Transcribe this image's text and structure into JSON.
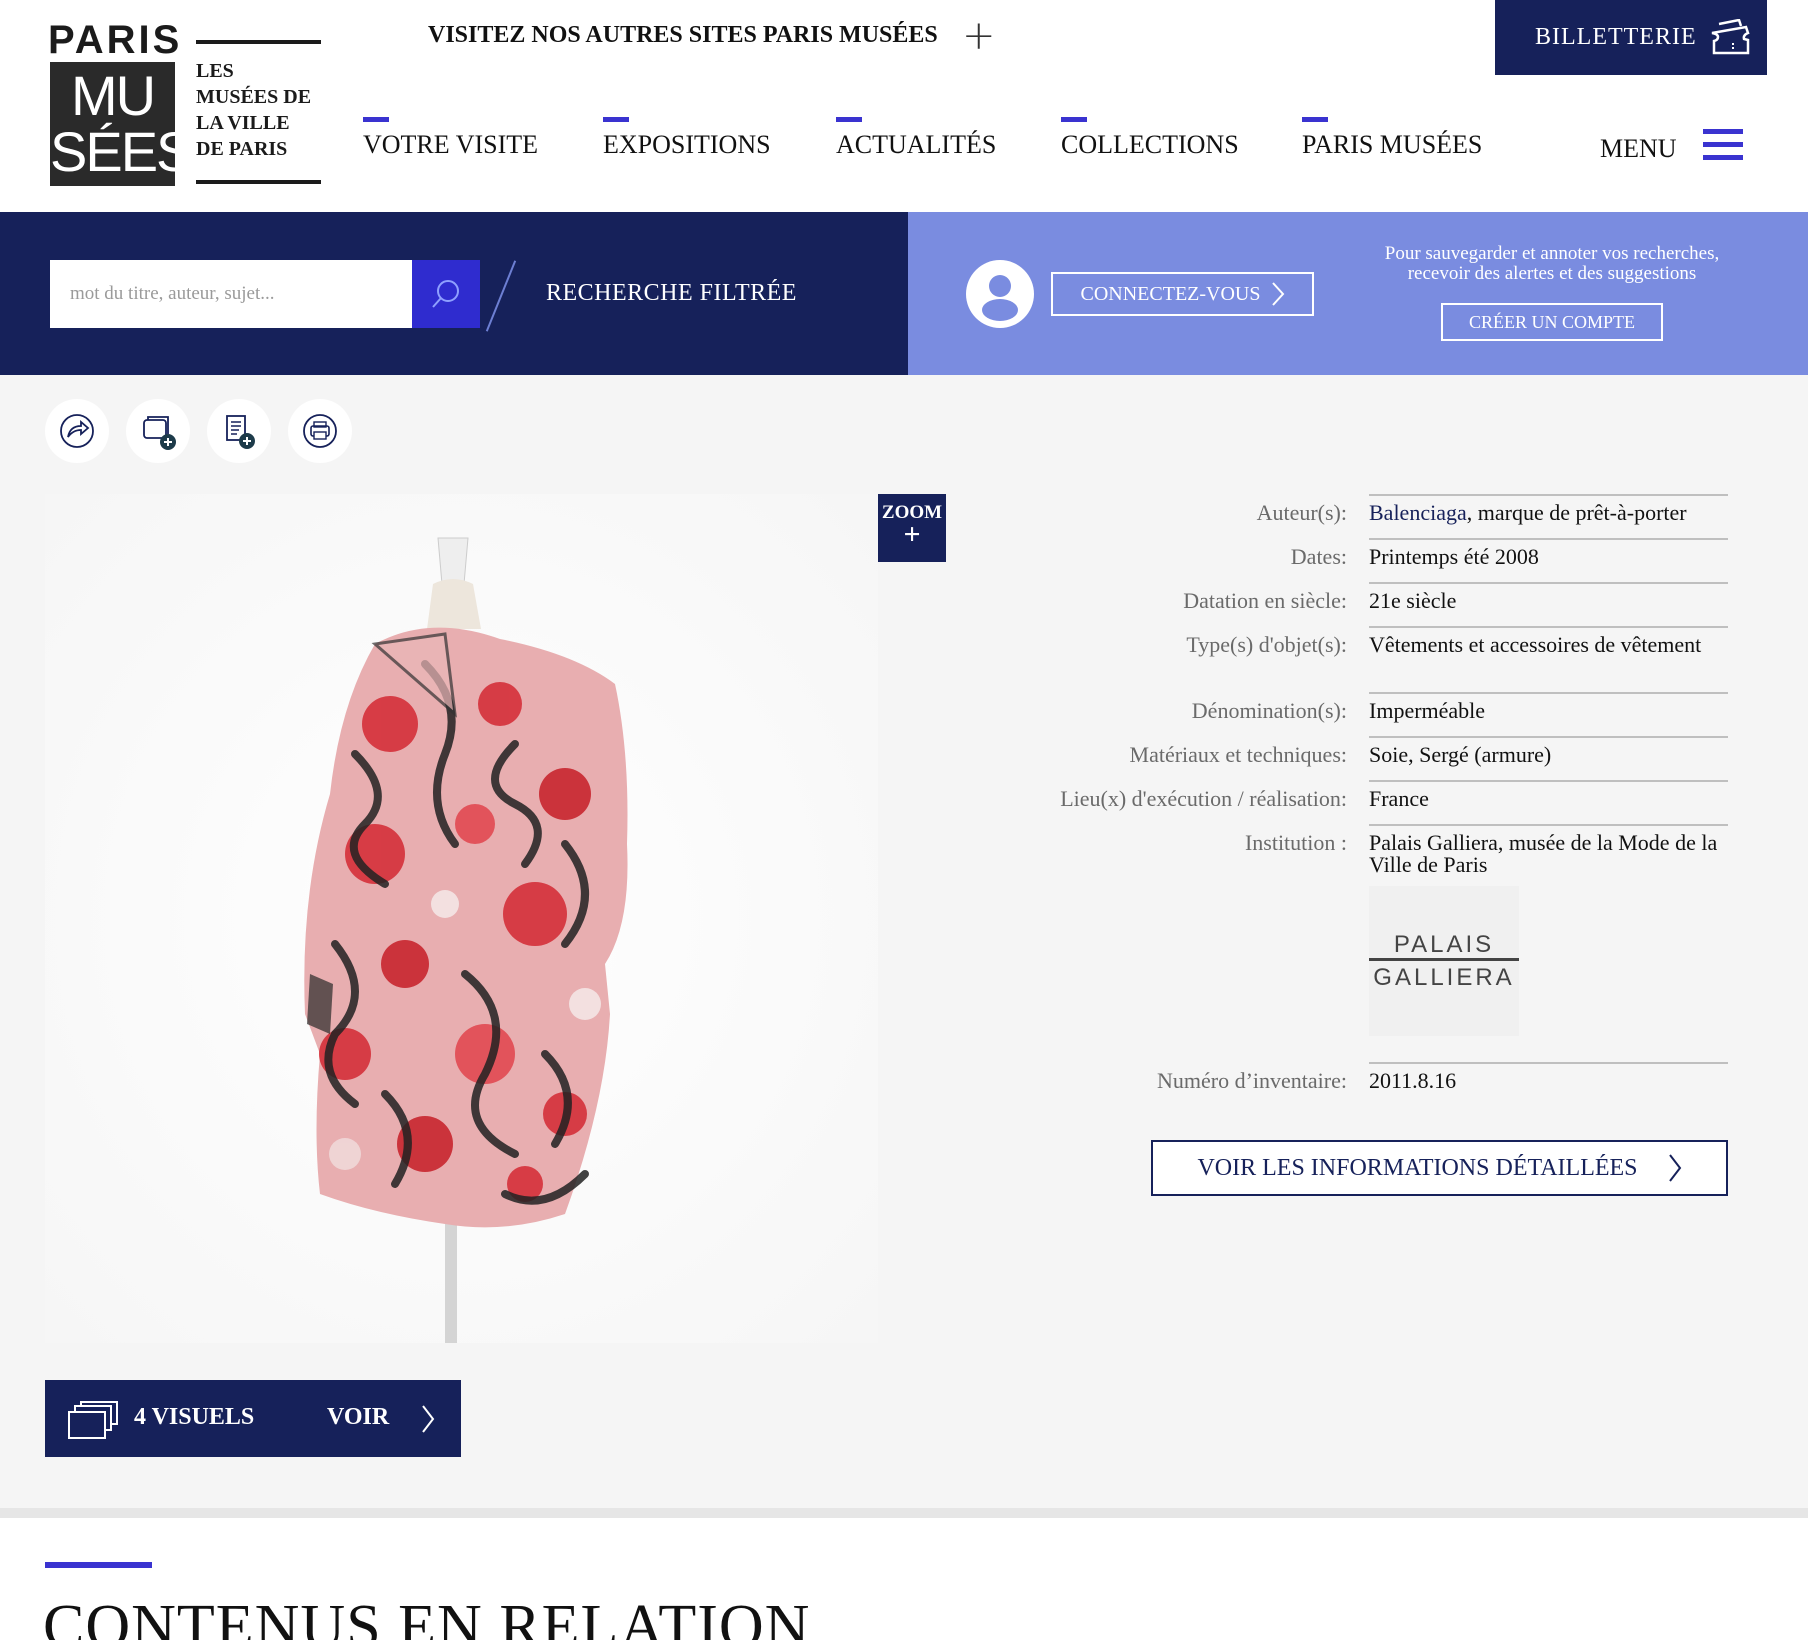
{
  "header": {
    "logo_word": "PARIS",
    "logo_mark": "MU SÉES",
    "logo_sub": [
      "LES",
      "MUSÉES DE",
      "LA VILLE",
      "DE PARIS"
    ],
    "visit_other": "VISITEZ NOS AUTRES SITES PARIS MUSÉES",
    "ticketing": "BILLETTERIE",
    "nav": [
      "VOTRE VISITE",
      "EXPOSITIONS",
      "ACTUALITÉS",
      "COLLECTIONS",
      "PARIS MUSÉES"
    ],
    "menu": "MENU"
  },
  "search": {
    "placeholder": "mot du titre, auteur, sujet...",
    "filtered": "RECHERCHE FILTRÉE"
  },
  "account": {
    "connect": "CONNECTEZ-VOUS",
    "promo": "Pour sauvegarder et annoter vos recherches, recevoir des alertes et des suggestions",
    "create": "CRÉER UN COMPTE"
  },
  "tools": [
    "share-icon",
    "add-to-album-icon",
    "add-to-list-icon",
    "print-icon"
  ],
  "image": {
    "zoom": "ZOOM",
    "visuels": "4 VISUELS",
    "voir": "VOIR"
  },
  "details": [
    {
      "label": "Auteur(s):",
      "value_link": "Balenciaga",
      "value": ", marque de prêt-à-porter"
    },
    {
      "label": "Dates:",
      "value": "Printemps été 2008"
    },
    {
      "label": "Datation en siècle:",
      "value_link": "21e siècle"
    },
    {
      "label": "Type(s) d'objet(s):",
      "value_link": "Vêtements et accessoires de vêtement"
    },
    {
      "label": "Dénomination(s):",
      "value_link": "Imperméable"
    },
    {
      "label": "Matériaux et techniques:",
      "value_link": "Soie, Sergé (armure)"
    },
    {
      "label": "Lieu(x) d'exécution / réalisation:",
      "value_link": "France"
    },
    {
      "label": "Institution :",
      "value_link": "Palais Galliera, musée de la Mode de la Ville de Paris"
    },
    {
      "label": "Numéro d’inventaire:",
      "value": "2011.8.16"
    }
  ],
  "institution_logo": [
    "PALAIS",
    "GALLIERA"
  ],
  "detail_button": "VOIR LES INFORMATIONS DÉTAILLÉES",
  "related_title": "CONTENUS EN RELATION",
  "colors": {
    "navy": "#16215a",
    "accent": "#3a33d0",
    "band_light": "#7a8ce0"
  }
}
